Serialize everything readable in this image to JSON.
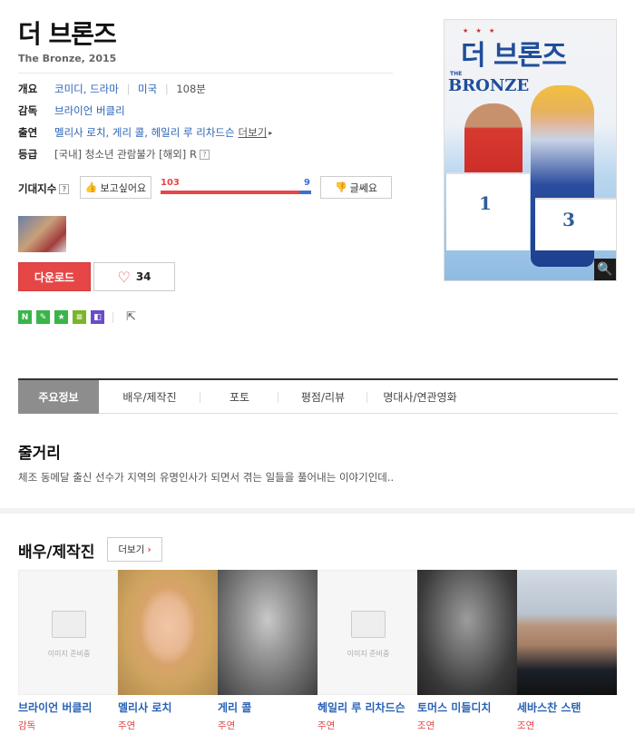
{
  "movie": {
    "title": "더 브론즈",
    "subtitle": "The Bronze, 2015"
  },
  "info": {
    "overview_label": "개요",
    "genre1": "코미디",
    "genre2": "드라마",
    "country": "미국",
    "runtime": "108분",
    "director_label": "감독",
    "director": "브라이언 버클리",
    "cast_label": "출연",
    "cast_names": "멜리사 로치, 게리 콜, 헤일리 루 리차드슨",
    "cast_more": "더보기",
    "rating_label": "등급",
    "rating_value": "[국내] 청소년 관람불가 [해외] R"
  },
  "expect": {
    "label": "기대지수",
    "want_label": "보고싶어요",
    "meh_label": "글쎄요",
    "want_count": "103",
    "meh_count": "9",
    "want_ratio": 0.92
  },
  "actions": {
    "download_label": "다운로드",
    "like_count": "34"
  },
  "share_services": [
    "N",
    "✎",
    "★",
    "≡",
    "◧"
  ],
  "colors": {
    "accent_red": "#e64646",
    "link_blue": "#2962b6",
    "svc_green": "#39b54a",
    "svc_purple": "#6a4cc9"
  },
  "poster": {
    "title": "더 브론즈",
    "english": "BRONZE",
    "the": "THE",
    "stars": "★ ★ ★",
    "podium_1": "1",
    "podium_3": "3"
  },
  "tabs": [
    {
      "label": "주요정보"
    },
    {
      "label": "배우/제작진"
    },
    {
      "label": "포토"
    },
    {
      "label": "평점/리뷰"
    },
    {
      "label": "명대사/연관영화"
    }
  ],
  "synopsis": {
    "heading": "줄거리",
    "text": "체조 동메달 출신 선수가 지역의 유명인사가 되면서 겪는 일들을 풀어내는 이야기인데.."
  },
  "cast_section": {
    "heading": "배우/제작진",
    "more_label": "더보기",
    "placeholder_text": "이미지 준비중",
    "people": [
      {
        "name": "브라이언 버클리",
        "role": "감독"
      },
      {
        "name": "멜리사 로치",
        "role": "주연"
      },
      {
        "name": "게리 콜",
        "role": "주연"
      },
      {
        "name": "헤일리 루 리차드슨",
        "role": "주연"
      },
      {
        "name": "토머스 미들디치",
        "role": "조연"
      },
      {
        "name": "세바스찬 스탠",
        "role": "조연"
      }
    ]
  }
}
